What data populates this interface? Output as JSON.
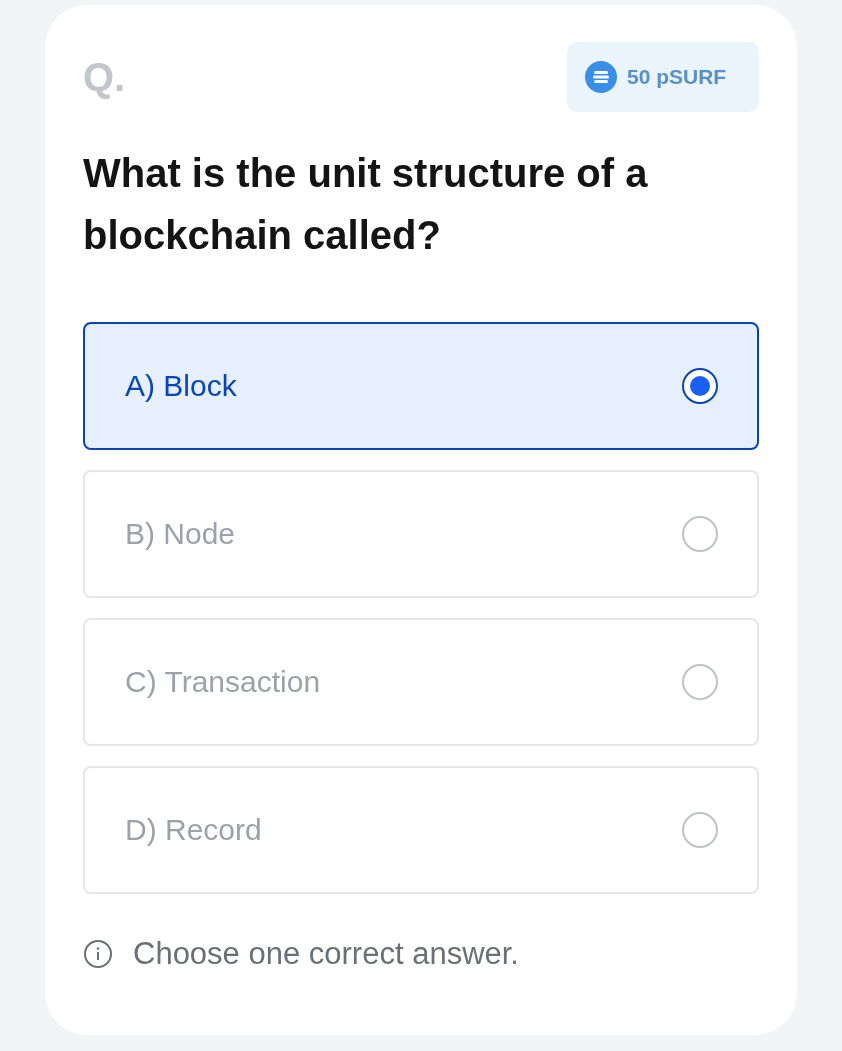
{
  "question_mark": "Q.",
  "reward": {
    "label": "50 pSURF"
  },
  "question": "What is the unit structure of a blockchain called?",
  "options": [
    {
      "label": "A) Block",
      "selected": true
    },
    {
      "label": "B) Node",
      "selected": false
    },
    {
      "label": "C) Transaction",
      "selected": false
    },
    {
      "label": "D) Record",
      "selected": false
    }
  ],
  "hint": "Choose one correct answer."
}
